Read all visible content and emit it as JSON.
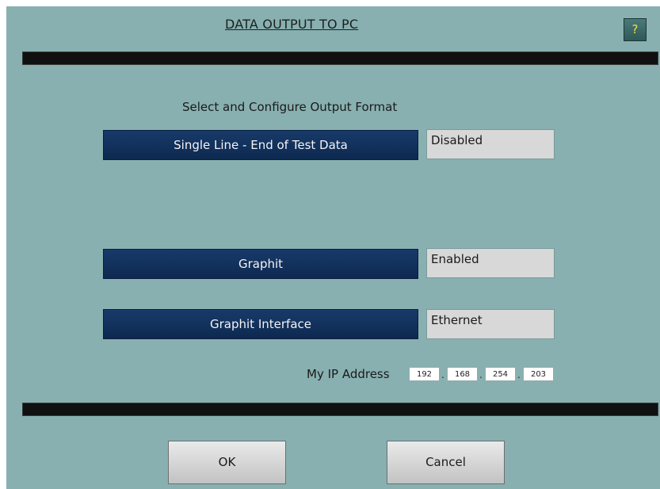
{
  "header": {
    "title": "DATA OUTPUT TO PC ",
    "help_label": "?"
  },
  "section_label": "Select and Configure Output Format",
  "options": [
    {
      "label": "Single Line - End of Test Data",
      "status": "Disabled"
    },
    {
      "label": "Graphit",
      "status": "Enabled"
    },
    {
      "label": "Graphit Interface",
      "status": "Ethernet"
    }
  ],
  "ip": {
    "label": "My IP Address",
    "octets": [
      "192",
      "168",
      "254",
      "203"
    ],
    "separator": "."
  },
  "footer": {
    "ok_label": "OK",
    "cancel_label": "Cancel"
  },
  "colors": {
    "background": "#88b0b0",
    "button_blue": "#0d2950",
    "status_gray": "#d8d8d8",
    "separator_bar": "#101010",
    "help_text": "#f0e040"
  }
}
